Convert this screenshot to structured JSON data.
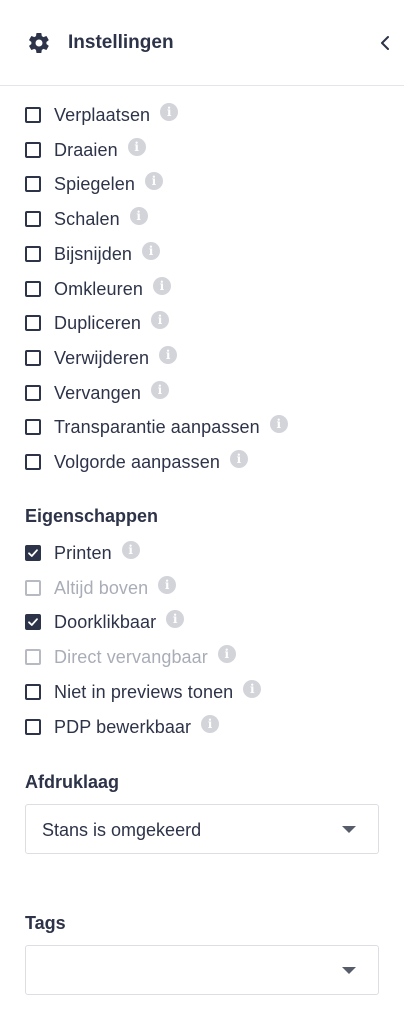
{
  "header": {
    "title": "Instellingen"
  },
  "actions": [
    {
      "label": "Verplaatsen",
      "checked": false,
      "disabled": false
    },
    {
      "label": "Draaien",
      "checked": false,
      "disabled": false
    },
    {
      "label": "Spiegelen",
      "checked": false,
      "disabled": false
    },
    {
      "label": "Schalen",
      "checked": false,
      "disabled": false
    },
    {
      "label": "Bijsnijden",
      "checked": false,
      "disabled": false
    },
    {
      "label": "Omkleuren",
      "checked": false,
      "disabled": false
    },
    {
      "label": "Dupliceren",
      "checked": false,
      "disabled": false
    },
    {
      "label": "Verwijderen",
      "checked": false,
      "disabled": false
    },
    {
      "label": "Vervangen",
      "checked": false,
      "disabled": false
    },
    {
      "label": "Transparantie aanpassen",
      "checked": false,
      "disabled": false
    },
    {
      "label": "Volgorde aanpassen",
      "checked": false,
      "disabled": false
    }
  ],
  "properties": {
    "title": "Eigenschappen",
    "items": [
      {
        "label": "Printen",
        "checked": true,
        "disabled": false
      },
      {
        "label": "Altijd boven",
        "checked": false,
        "disabled": true
      },
      {
        "label": "Doorklikbaar",
        "checked": true,
        "disabled": false
      },
      {
        "label": "Direct vervangbaar",
        "checked": false,
        "disabled": true
      },
      {
        "label": "Niet in previews tonen",
        "checked": false,
        "disabled": false
      },
      {
        "label": "PDP bewerkbaar",
        "checked": false,
        "disabled": false
      }
    ]
  },
  "print_layer": {
    "title": "Afdruklaag",
    "value": "Stans is omgekeerd"
  },
  "tags": {
    "title": "Tags",
    "value": ""
  },
  "icons": {
    "header": "gear-icon",
    "collapse": "chevron-left-icon",
    "info": "info-icon",
    "dropdown": "caret-down-icon"
  },
  "colors": {
    "text": "#2d3348",
    "disabled_text": "#a9adb7",
    "info_badge": "#d2d4d9",
    "border": "#dcdee3"
  }
}
